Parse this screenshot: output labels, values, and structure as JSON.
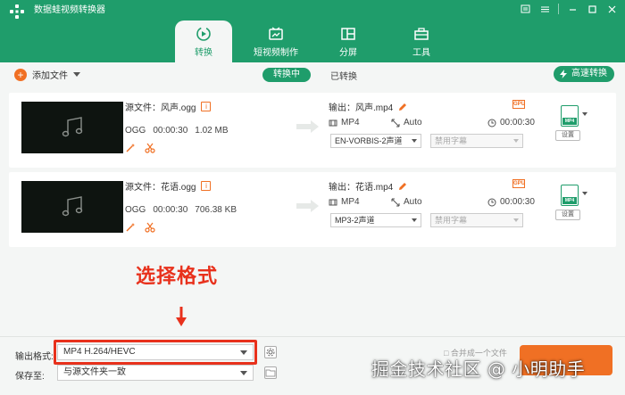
{
  "app": {
    "title": "数据蛙视频转换器",
    "colors": {
      "brand": "#1f9d6b",
      "accent": "#f07024",
      "highlight": "#e8311c"
    }
  },
  "window_controls": [
    "menu-icon",
    "feedback-icon",
    "minimize-icon",
    "maximize-icon",
    "close-icon"
  ],
  "nav": {
    "tabs": [
      {
        "label": "转换",
        "icon": "convert-icon",
        "active": true
      },
      {
        "label": "短视频制作",
        "icon": "short-video-icon",
        "active": false
      },
      {
        "label": "分屏",
        "icon": "split-screen-icon",
        "active": false
      },
      {
        "label": "工具",
        "icon": "toolbox-icon",
        "active": false
      }
    ]
  },
  "toolbar": {
    "add_file": "添加文件",
    "tab_converting": "转换中",
    "tab_converted": "已转换",
    "turbo": "高速转换"
  },
  "files": [
    {
      "source_label": "源文件：风声.ogg",
      "format": "OGG",
      "duration": "00:00:30",
      "size": "1.02 MB",
      "output_label": "输出：风声.mp4",
      "out_format": "MP4",
      "out_resolution": "Auto",
      "out_duration": "00:00:30",
      "audio_track": "EN-VORBIS-2声道",
      "subtitle": "禁用字幕",
      "settings": "设置",
      "format_badge": "MP4",
      "hw_badge": "GPU"
    },
    {
      "source_label": "源文件：花语.ogg",
      "format": "OGG",
      "duration": "00:00:30",
      "size": "706.38 KB",
      "output_label": "输出：花语.mp4",
      "out_format": "MP4",
      "out_resolution": "Auto",
      "out_duration": "00:00:30",
      "audio_track": "MP3-2声道",
      "subtitle": "禁用字幕",
      "settings": "设置",
      "format_badge": "MP4",
      "hw_badge": "GPU"
    }
  ],
  "annotation": {
    "text": "选择格式"
  },
  "bottom": {
    "output_format_label": "输出格式:",
    "output_format_value": "MP4 H.264/HEVC",
    "save_to_label": "保存至:",
    "save_to_value": "与源文件夹一致",
    "partial_text": "□ 合并成一个文件"
  },
  "watermark": "掘金技术社区 @ 小明助手"
}
